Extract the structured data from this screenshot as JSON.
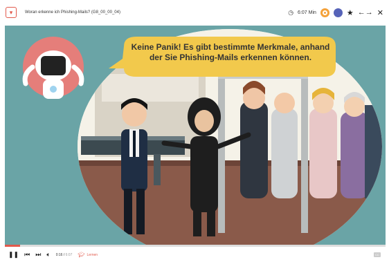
{
  "header": {
    "title": "Woran erkenne ich Phishing-Mails? (G8_00_00_04)",
    "duration": "6:07 Min"
  },
  "video": {
    "speech": "Keine Panik! Es gibt bestimmte Merkmale, anhand der Sie Phishing-Mails erkennen können.",
    "progress": 0.04
  },
  "player": {
    "time_current": "0:16",
    "time_total": "6:07",
    "learn_label": "Lernen",
    "cc_label": "CC"
  },
  "colors": {
    "accent": "#e25a4c",
    "video_bg": "#6aa4a6",
    "bubble": "#f2c94c"
  }
}
